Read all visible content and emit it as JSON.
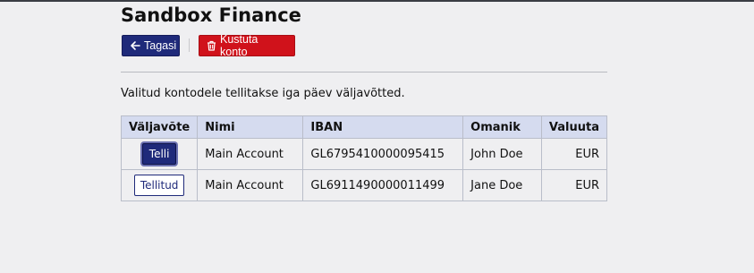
{
  "header": {
    "title": "Sandbox Finance"
  },
  "toolbar": {
    "back_label": "Tagasi",
    "delete_label": "Kustuta konto",
    "back_color": "#1f2a7a",
    "delete_color": "#d0121b"
  },
  "info": {
    "text": "Valitud kontodele tellitakse iga päev väljavõtted."
  },
  "table": {
    "headers": [
      "Väljavõte",
      "Nimi",
      "IBAN",
      "Omanik",
      "Valuuta"
    ],
    "rows": [
      {
        "action": "Telli",
        "name": "Main Account",
        "iban": "GL6795410000095415",
        "owner": "John Doe",
        "currency": "EUR"
      },
      {
        "action": "Tellitud",
        "name": "Main Account",
        "iban": "GL6911490000011499",
        "owner": "Jane Doe",
        "currency": "EUR"
      }
    ]
  }
}
